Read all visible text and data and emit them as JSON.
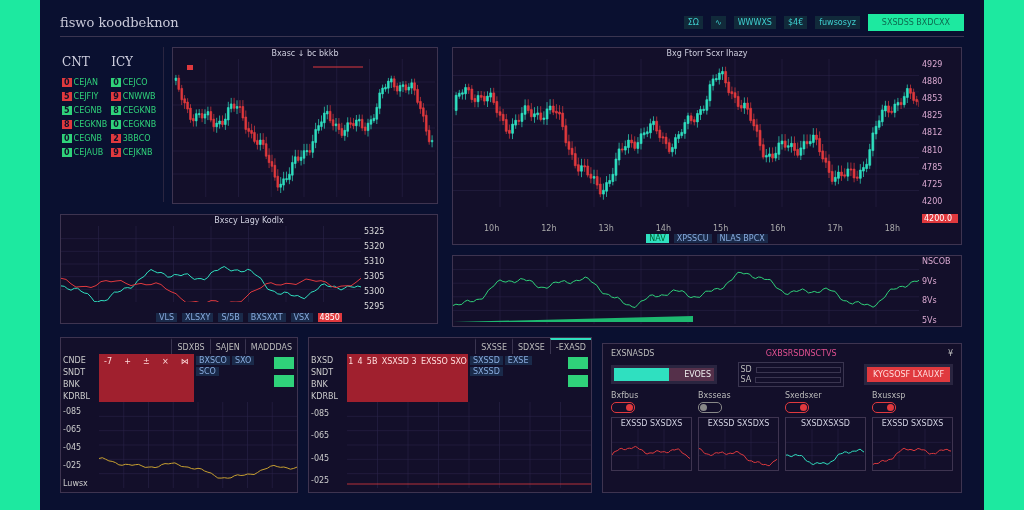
{
  "header": {
    "title": "fiswo koodbeknon",
    "toolbar": [
      "ΣΩ",
      "∿",
      "WWWXS",
      "$4€",
      "fuwsosyz"
    ],
    "action_button": "SXSDSS BXDCXX"
  },
  "watchlist": [
    {
      "heading": "CNT",
      "items": [
        {
          "code": "0",
          "name": "CEJAN",
          "color": "#e0393e"
        },
        {
          "code": "5",
          "name": "CEJFIY",
          "color": "#e0393e"
        },
        {
          "code": "5",
          "name": "CEGNB",
          "color": "#2fd27a"
        },
        {
          "code": "8",
          "name": "CEGKNB",
          "color": "#e0393e"
        },
        {
          "code": "0",
          "name": "CEGNB",
          "color": "#2fd27a"
        },
        {
          "code": "0",
          "name": "CEJAUB",
          "color": "#2fd27a"
        }
      ]
    },
    {
      "heading": "ICY",
      "items": [
        {
          "code": "0",
          "name": "CEJCO",
          "color": "#2fd27a"
        },
        {
          "code": "9",
          "name": "CNWWB",
          "color": "#e0393e"
        },
        {
          "code": "8",
          "name": "CEGKNB",
          "color": "#2fd27a"
        },
        {
          "code": "0",
          "name": "CEGKNB",
          "color": "#2fd27a"
        },
        {
          "code": "2",
          "name": "3BBCO",
          "color": "#e0393e"
        },
        {
          "code": "9",
          "name": "CEJKNB",
          "color": "#e0393e"
        }
      ]
    }
  ],
  "chart_small": {
    "title": "Bxasc ↓ bc bkkb"
  },
  "chart_main": {
    "title": "Bxg Ftorr Scxr Ihazy",
    "y_labels": [
      "4929",
      "4880",
      "4853",
      "4825",
      "4812",
      "4810",
      "4785",
      "4725",
      "4200"
    ],
    "price_tag": "4200.0",
    "x_labels": [
      "10h",
      "12h",
      "13h",
      "14h",
      "15h",
      "16h",
      "17h",
      "18h"
    ],
    "legend": [
      {
        "label": "NAV",
        "selected": true
      },
      {
        "label": "XPSSCU",
        "selected": false
      },
      {
        "label": "NLAS BPCX",
        "selected": false
      }
    ]
  },
  "chart_trend": {
    "title": "Bxscy Lagy Kodlx",
    "y_labels": [
      "5325",
      "5320",
      "5310",
      "5305",
      "5300",
      "5295"
    ],
    "marker_tag": "4850",
    "legend": [
      "VLS",
      "XLSXY",
      "S/5B",
      "BXSXXT",
      "VSX"
    ]
  },
  "chart_volume": {
    "y_labels": [
      "NSCOB",
      "9Vs",
      "8Vs",
      "5Vs"
    ]
  },
  "order_panels": [
    {
      "tabs": [
        {
          "label": "SDXBS",
          "selected": false
        },
        {
          "label": "SAJEN",
          "selected": false
        },
        {
          "label": "MADDDAS",
          "selected": false
        }
      ],
      "row_labels": [
        "CNDE",
        "SNDT",
        "BNK",
        "KDRBL"
      ],
      "y_labels": [
        "-085",
        "-065",
        "-045",
        "-025",
        "Luwsx"
      ],
      "red_cells": [
        "-7",
        "+",
        "±",
        "×",
        "⋈"
      ],
      "chips": [
        "BXSCO",
        "SXO",
        "SCO"
      ]
    },
    {
      "tabs": [
        {
          "label": "SXSSE",
          "selected": false
        },
        {
          "label": "SDXSE",
          "selected": false
        },
        {
          "label": "-EXASD",
          "selected": true
        }
      ],
      "row_labels": [
        "BXSD",
        "SNDT",
        "BNK",
        "KDRBL"
      ],
      "y_labels": [
        "-085",
        "-065",
        "-045",
        "-025"
      ],
      "red_cells": [
        "1",
        "4",
        "5B",
        "XSXSD 3",
        "EXSSO SXO"
      ],
      "chips": [
        "SXSSD",
        "EXSE",
        "SXSSD"
      ]
    }
  ],
  "control_panel": {
    "label": "EXSNASDS",
    "title": "GXBSRSDNSCTVS",
    "meter": {
      "level": 0.55,
      "reading": "EVOES"
    },
    "slider_rows": [
      "SD",
      "SA"
    ],
    "alert_icon": "¥",
    "alert_button": "KYGSOSF LXAUXF",
    "groups": [
      {
        "label": "Bxfbus",
        "on": true
      },
      {
        "label": "Bxsseas",
        "on": false
      },
      {
        "label": "Sxedsxer",
        "on": true
      },
      {
        "label": "Bxusxsp",
        "on": true
      }
    ],
    "mini_charts": [
      {
        "title": "EXSSD SXSDXS"
      },
      {
        "title": "EXSSD SXSDXS"
      },
      {
        "title": "SXSDXSXSD"
      },
      {
        "title": "EXSSD SXSDXS"
      }
    ]
  }
}
